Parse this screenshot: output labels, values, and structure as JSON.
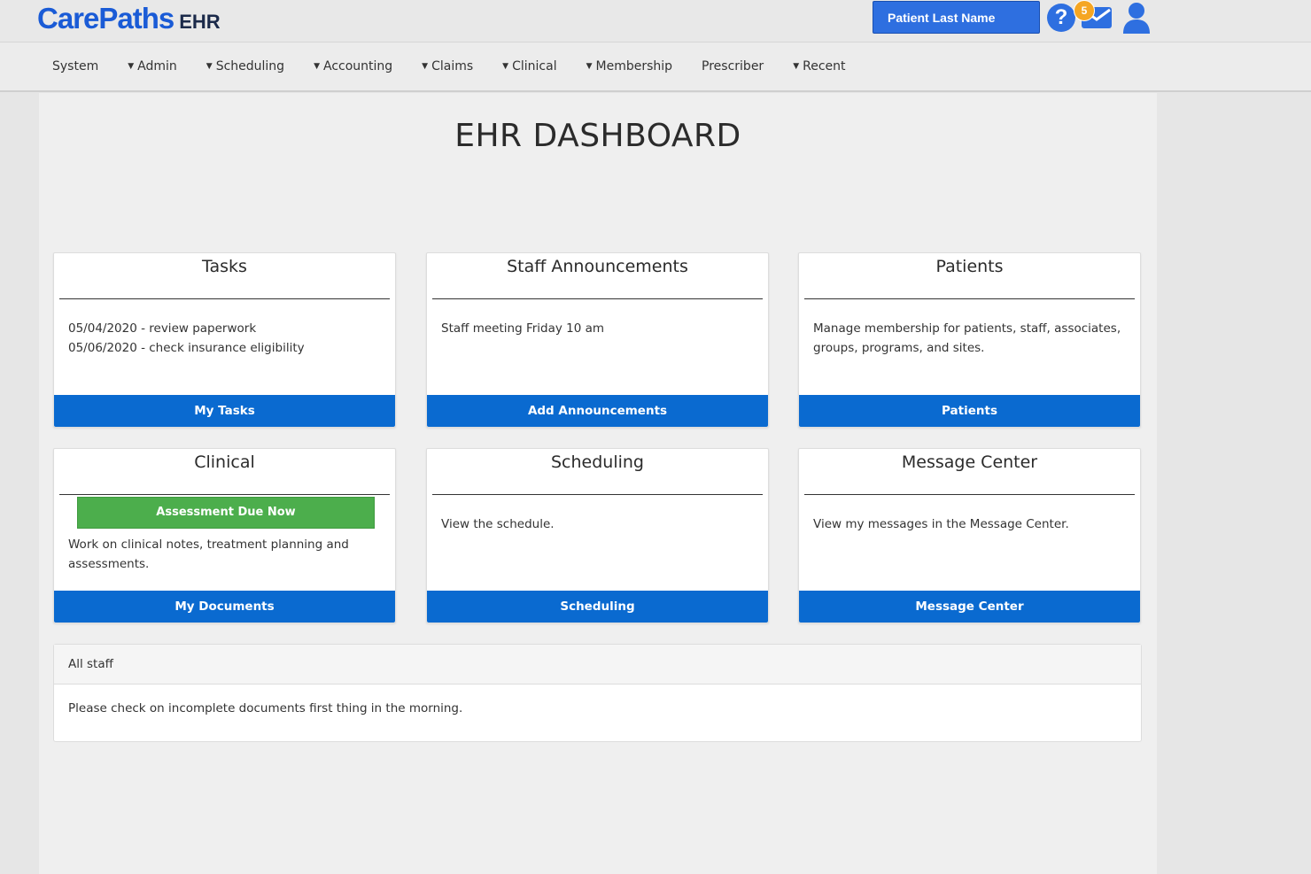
{
  "header": {
    "logo_main": "CarePaths",
    "logo_sub": "EHR",
    "search_placeholder": "Patient Last Name",
    "help_symbol": "?",
    "mail_badge_count": "5"
  },
  "nav": {
    "items": [
      {
        "label": "System",
        "dropdown": false
      },
      {
        "label": "Admin",
        "dropdown": true
      },
      {
        "label": "Scheduling",
        "dropdown": true
      },
      {
        "label": "Accounting",
        "dropdown": true
      },
      {
        "label": "Claims",
        "dropdown": true
      },
      {
        "label": "Clinical",
        "dropdown": true
      },
      {
        "label": "Membership",
        "dropdown": true
      },
      {
        "label": "Prescriber",
        "dropdown": false
      },
      {
        "label": "Recent",
        "dropdown": true
      }
    ]
  },
  "page": {
    "title": "EHR DASHBOARD"
  },
  "cards": {
    "tasks": {
      "title": "Tasks",
      "lines": [
        "05/04/2020 - review paperwork",
        "05/06/2020 - check insurance eligibility"
      ],
      "button": "My Tasks"
    },
    "announcements": {
      "title": "Staff Announcements",
      "body": "Staff meeting Friday 10 am",
      "button": "Add Announcements"
    },
    "patients": {
      "title": "Patients",
      "body": "Manage membership for patients, staff, associates, groups, programs, and sites.",
      "button": "Patients"
    },
    "clinical": {
      "title": "Clinical",
      "alert_button": "Assessment Due Now",
      "body": "Work on clinical notes, treatment planning and assessments.",
      "button": "My Documents"
    },
    "scheduling": {
      "title": "Scheduling",
      "body": "View the schedule.",
      "button": "Scheduling"
    },
    "messages": {
      "title": "Message Center",
      "body": "View my messages in the Message Center.",
      "button": "Message Center"
    }
  },
  "announcement_panel": {
    "heading": "All staff",
    "body": "Please check on incomplete documents first thing in the morning."
  },
  "colors": {
    "primary": "#0a6ad0",
    "logo": "#1a5bd6",
    "alert_green": "#4cae4c",
    "badge": "#f5a623"
  },
  "icons": [
    "help-icon",
    "mail-icon",
    "user-icon",
    "caret-down-icon"
  ]
}
